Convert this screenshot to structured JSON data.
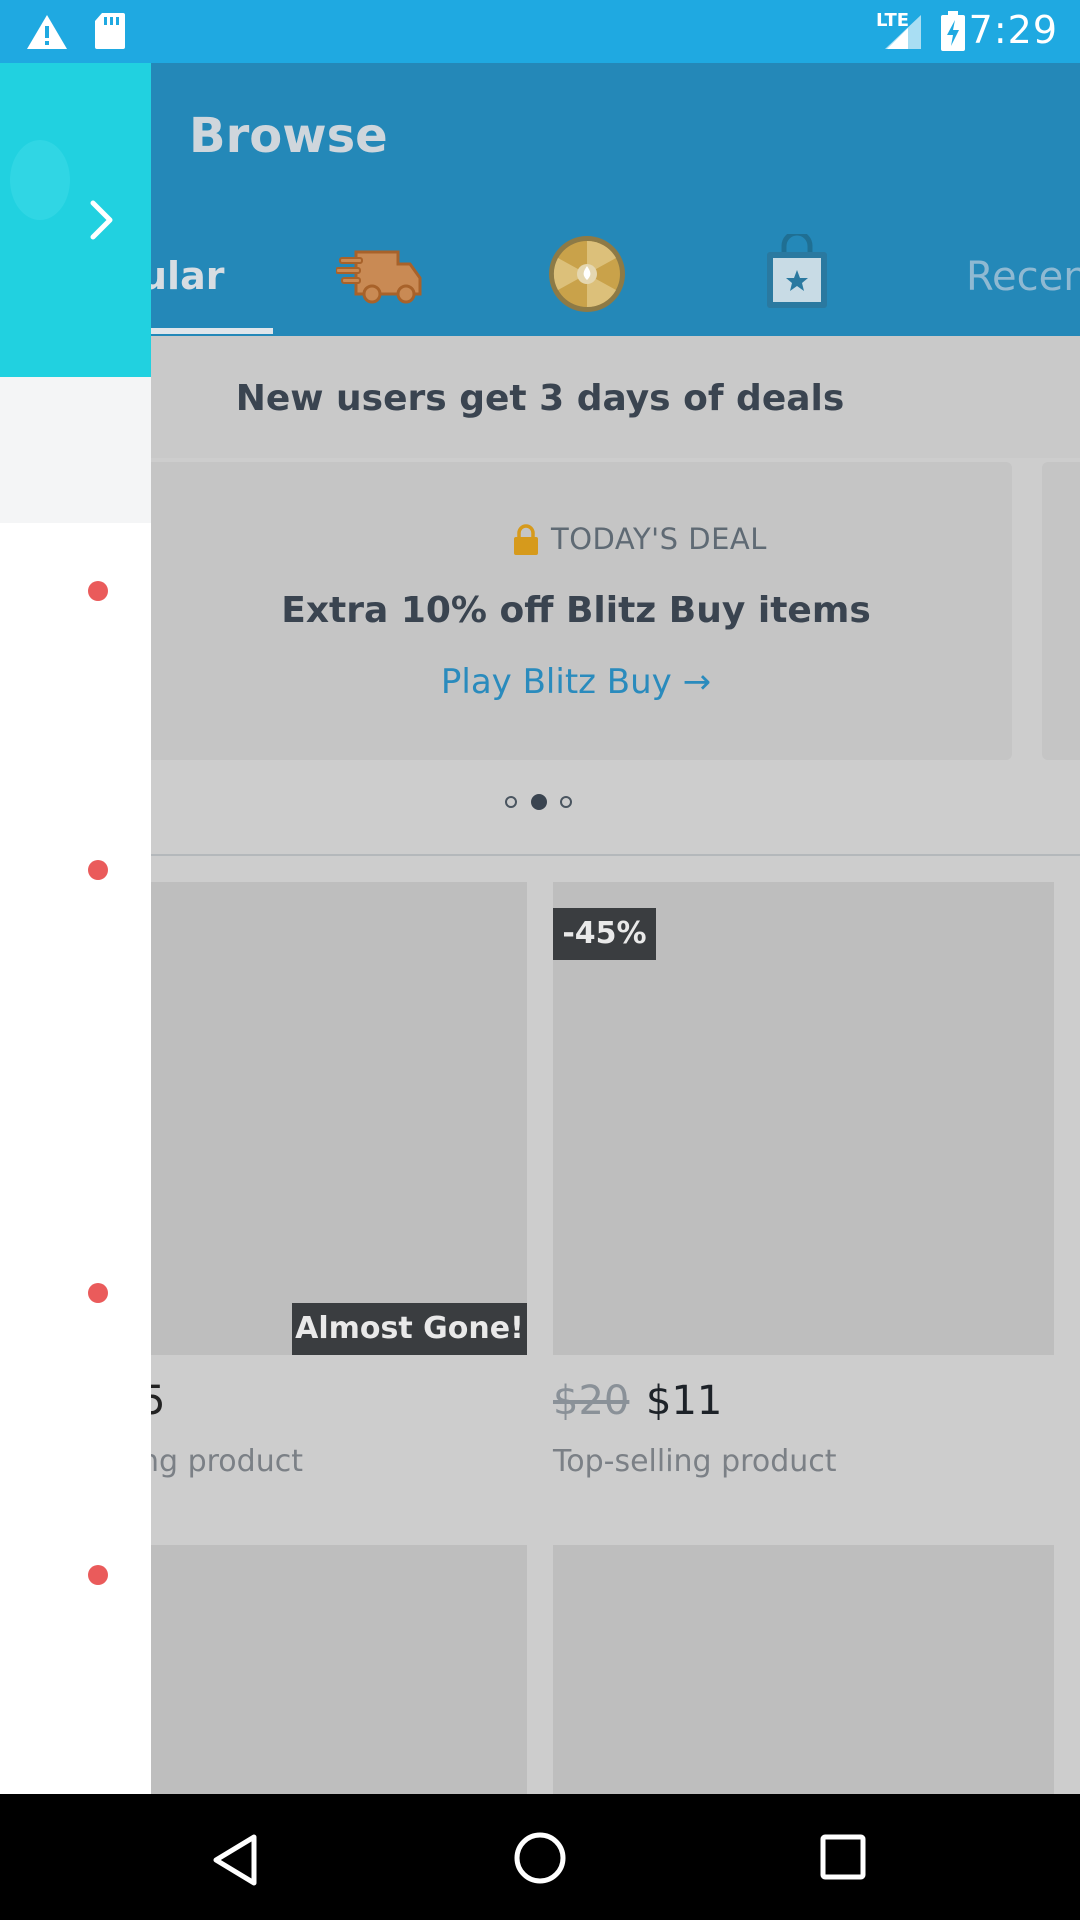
{
  "status_bar": {
    "time": "7:29",
    "network_label": "LTE",
    "icons": [
      "warning-icon",
      "sd-card-icon",
      "signal-icon",
      "battery-charging-icon"
    ]
  },
  "header": {
    "title": "Browse"
  },
  "tabs": [
    {
      "label": "Popular",
      "visible_label": "ular",
      "selected": true
    },
    {
      "icon": "delivery-truck-icon"
    },
    {
      "icon": "blitz-wheel-icon"
    },
    {
      "icon": "shopping-bag-star-icon"
    },
    {
      "label": "Recent",
      "visible_label": "Recen"
    }
  ],
  "promo": {
    "text": "New users get 3 days of deals"
  },
  "deal_card": {
    "label": "TODAY'S DEAL",
    "title": "Extra 10% off Blitz Buy items",
    "link": "Play Blitz Buy →",
    "icon": "lock-icon",
    "lock_color": "#d69a1c"
  },
  "pager": {
    "count": 3,
    "active_index": 1
  },
  "products": [
    {
      "badge": "Almost Gone!",
      "price": "5",
      "subtitle": "ng product"
    },
    {
      "badge": "-45%",
      "old_price": "$20",
      "price": "$11",
      "subtitle": "Top-selling product"
    }
  ],
  "drawer": {
    "toggle_icon": "chevron-right-icon",
    "accent": "#21d1e0",
    "marker_color": "#ea5b5b"
  },
  "colors": {
    "status_bar": "#1fa9e1",
    "app_bar": "#2488b8"
  },
  "nav_bar": {
    "icons": [
      "back-icon",
      "home-icon",
      "recents-icon"
    ]
  }
}
